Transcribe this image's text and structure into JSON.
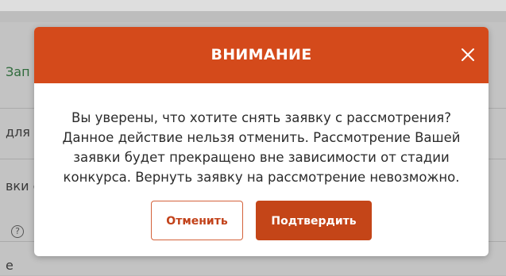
{
  "background": {
    "row1_text": "Зап",
    "row2_text": "для",
    "row3_text": "вки с",
    "row4_text": "?",
    "row5_text": "е"
  },
  "modal": {
    "title": "ВНИМАНИЕ",
    "close_icon": "close-icon",
    "message": "Вы уверены, что хотите снять заявку с рассмотрения? Данное действие нельзя отменить. Рассмотрение Вашей заявки будет прекращено вне зависимости от стадии конкурса. Вернуть заявку на рассмотрение невозможно.",
    "cancel_label": "Отменить",
    "confirm_label": "Подтвердить"
  },
  "colors": {
    "header_bg": "#d44a1b",
    "confirm_bg": "#c44518",
    "cancel_border": "#d4623b",
    "cancel_text": "#c2421a"
  }
}
